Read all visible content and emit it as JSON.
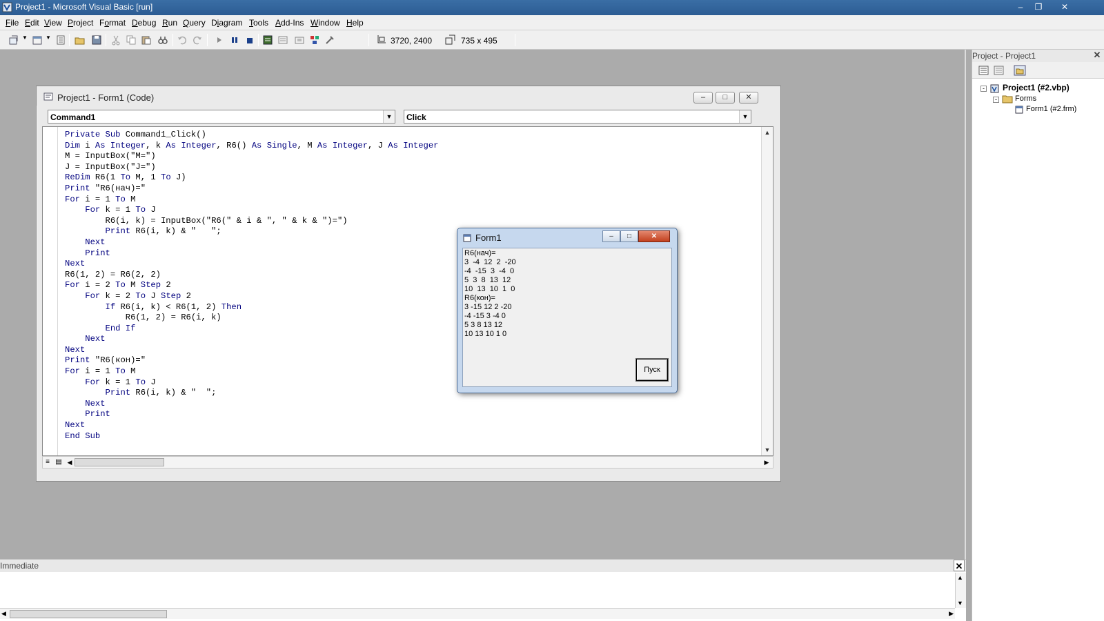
{
  "window": {
    "title": "Project1 - Microsoft Visual Basic [run]"
  },
  "menu": [
    {
      "label": "File",
      "u": "F",
      "rest": "ile"
    },
    {
      "label": "Edit",
      "u": "E",
      "rest": "dit"
    },
    {
      "label": "View",
      "u": "V",
      "rest": "iew"
    },
    {
      "label": "Project",
      "u": "P",
      "rest": "roject"
    },
    {
      "label": "Format",
      "u": "o",
      "pre": "F",
      "rest": "rmat"
    },
    {
      "label": "Debug",
      "u": "D",
      "rest": "ebug"
    },
    {
      "label": "Run",
      "u": "R",
      "rest": "un"
    },
    {
      "label": "Query",
      "u": "Q",
      "rest": "uery"
    },
    {
      "label": "Diagram",
      "u": "i",
      "pre": "D",
      "rest": "agram"
    },
    {
      "label": "Tools",
      "u": "T",
      "rest": "ools"
    },
    {
      "label": "Add-Ins",
      "u": "A",
      "rest": "dd-Ins"
    },
    {
      "label": "Window",
      "u": "W",
      "rest": "indow"
    },
    {
      "label": "Help",
      "u": "H",
      "rest": "elp"
    }
  ],
  "toolbar": {
    "position": "3720, 2400",
    "size": "735 x 495"
  },
  "code_window": {
    "title": "Project1 - Form1 (Code)",
    "object_combo": "Command1",
    "procedure_combo": "Click",
    "lines": [
      "Private Sub Command1_Click()",
      "Dim i As Integer, k As Integer, R6() As Single, M As Integer, J As Integer",
      "M = InputBox(\"M=\")",
      "J = InputBox(\"J=\")",
      "ReDim R6(1 To M, 1 To J)",
      "Print \"R6(нач)=\"",
      "For i = 1 To M",
      "    For k = 1 To J",
      "        R6(i, k) = InputBox(\"R6(\" & i & \", \" & k & \")=\")",
      "        Print R6(i, k) & \"   \";",
      "    Next",
      "    Print",
      "Next",
      "R6(1, 2) = R6(2, 2)",
      "For i = 2 To M Step 2",
      "    For k = 2 To J Step 2",
      "        If R6(i, k) < R6(1, 2) Then",
      "            R6(1, 2) = R6(i, k)",
      "        End If",
      "    Next",
      "Next",
      "Print \"R6(кон)=\"",
      "For i = 1 To M",
      "    For k = 1 To J",
      "        Print R6(i, k) & \"  \";",
      "    Next",
      "    Print",
      "Next",
      "End Sub"
    ]
  },
  "form1": {
    "title": "Form1",
    "output": [
      "R6(нач)=",
      "3  -4  12  2  -20",
      "-4  -15  3  -4  0",
      "5  3  8  13  12",
      "10  13  10  1  0",
      "R6(кон)=",
      "3 -15 12 2 -20",
      "-4 -15 3 -4 0",
      "5 3 8 13 12",
      "10 13 10 1 0"
    ],
    "button_label": "Пуск"
  },
  "project_panel": {
    "title": "Project - Project1",
    "project_node": "Project1 (#2.vbp)",
    "forms_node": "Forms",
    "form_node": "Form1 (#2.frm)"
  },
  "immediate": {
    "title": "Immediate"
  },
  "keywords": [
    "Private",
    "Sub",
    "Dim",
    "As",
    "Integer",
    "Single",
    "ReDim",
    "To",
    "Print",
    "For",
    "Next",
    "Step",
    "If",
    "Then",
    "End"
  ]
}
